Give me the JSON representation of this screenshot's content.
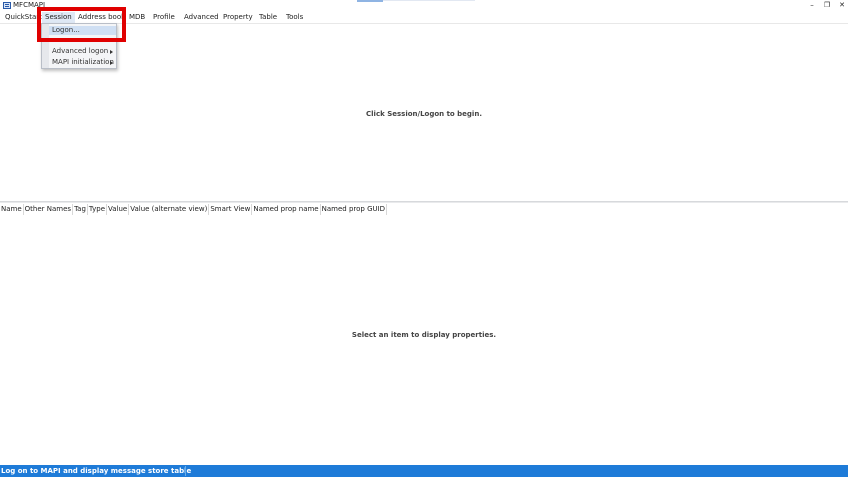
{
  "window": {
    "title": "MFCMAPI",
    "minimize_glyph": "–",
    "maximize_glyph": "❐",
    "close_glyph": "✕"
  },
  "menubar": {
    "items": [
      "QuickStart",
      "Session",
      "Address book",
      "MDB",
      "Profile",
      "Advanced",
      "Property",
      "Table",
      "Tools"
    ],
    "active": "Session"
  },
  "session_menu": {
    "items": [
      {
        "label": "Logon...",
        "submenu": false,
        "highlighted": true
      },
      {
        "label": "Advanced logon",
        "submenu": true,
        "highlighted": false
      },
      {
        "label": "MAPI initialization",
        "submenu": true,
        "highlighted": false
      }
    ]
  },
  "top_pane": {
    "message": "Click Session/Logon to begin."
  },
  "property_list": {
    "columns": [
      "Name",
      "Other Names",
      "Tag",
      "Type",
      "Value",
      "Value (alternate view)",
      "Smart View",
      "Named prop name",
      "Named prop GUID"
    ],
    "empty_message": "Select an item to display properties."
  },
  "statusbar": {
    "text": "Log on to MAPI and display message store table"
  },
  "colors": {
    "statusbar": "#1e7bd8",
    "highlight_box": "#e00000",
    "menu_hover": "#cfdff3"
  }
}
